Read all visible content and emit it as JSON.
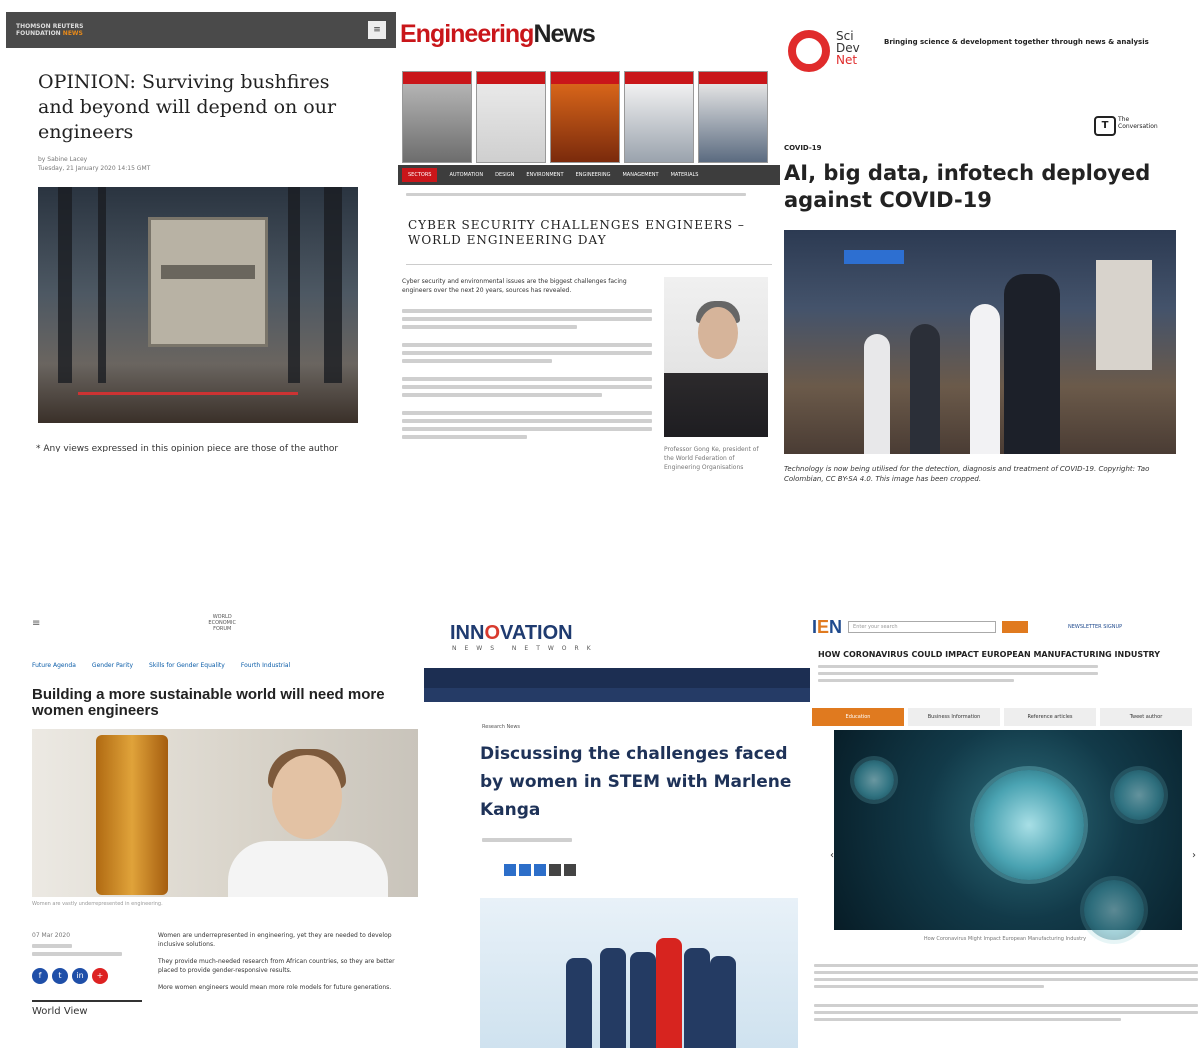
{
  "panel1": {
    "brand_line1": "THOMSON REUTERS",
    "brand_line2": "FOUNDATION",
    "brand_tag": "NEWS",
    "title": "OPINION: Surviving bushfires and beyond will depend on our engineers",
    "byline": "by Sabine Lacey",
    "date": "Tuesday, 21 January 2020 14:15 GMT",
    "caption": "* Any views expressed in this opinion piece are those of the author and not of Thomson Reuters Foundation."
  },
  "panel2": {
    "brand_red": "Engineering",
    "brand_dark": "News",
    "nav_items": [
      "SECTORS",
      "AUTOMATION",
      "DESIGN",
      "ENVIRONMENT",
      "ENGINEERING",
      "MANAGEMENT",
      "MATERIALS"
    ],
    "title": "CYBER SECURITY CHALLENGES ENGINEERS – WORLD ENGINEERING DAY",
    "lead": "Cyber security and environmental issues are the biggest challenges facing engineers over the next 20 years, sources has revealed.",
    "photo_caption": "Professor Gong Ke, president of the World Federation of Engineering Organisations"
  },
  "panel3": {
    "brand_sci": "Sci",
    "brand_dev": "Dev",
    "brand_net": "Net",
    "tagline": "Bringing science & development together through news & analysis",
    "conv_mark": "T",
    "conv_text": "The Conversation",
    "section": "COVID-19",
    "title": "AI, big data, infotech deployed against COVID-19",
    "caption": "Technology is now being utilised for the detection, diagnosis and treatment of COVID-19. Copyright: Tao Colombian, CC BY-SA 4.0. This image has been cropped."
  },
  "panel4": {
    "wef_line1": "WORLD",
    "wef_line2": "ECONOMIC",
    "wef_line3": "FORUM",
    "nav_links": [
      "Future Agenda",
      "Gender Parity",
      "Skills for Gender Equality",
      "Fourth Industrial"
    ],
    "title": "Building a more sustainable world will need more women engineers",
    "photo_caption": "Women are vastly underrepresented in engineering.",
    "date": "07 Mar 2020",
    "bullets": [
      "Women are underrepresented in engineering, yet they are needed to develop inclusive solutions.",
      "They provide much-needed research from African countries, so they are better placed to provide gender-responsive results.",
      "More women engineers would mean more role models for future generations."
    ],
    "views_label": "World View"
  },
  "panel5": {
    "logo_main_a": "INN",
    "logo_main_o": "O",
    "logo_main_b": "VATION",
    "logo_sub": "NEWS NETWORK",
    "category": "Research News",
    "title": "Discussing the challenges faced by women in STEM with Marlene Kanga"
  },
  "panel6": {
    "logo_a": "I",
    "logo_b": "E",
    "logo_c": "N",
    "search_placeholder": "Enter your search",
    "top_link": "NEWSLETTER SIGNUP",
    "title": "HOW CORONAVIRUS COULD IMPACT EUROPEAN MANUFACTURING INDUSTRY",
    "tabs": [
      "Education",
      "Business Information",
      "Reference articles",
      "Tweet author"
    ],
    "photo_caption": "How Coronavirus Might Impact European Manufacturing Industry"
  },
  "colors": {
    "reuters_bar": "#4a4a4a",
    "en_red": "#c9161a",
    "scidev_red": "#e02b2b",
    "inn_navy": "#1f3b70",
    "ien_orange": "#e07a1f"
  }
}
